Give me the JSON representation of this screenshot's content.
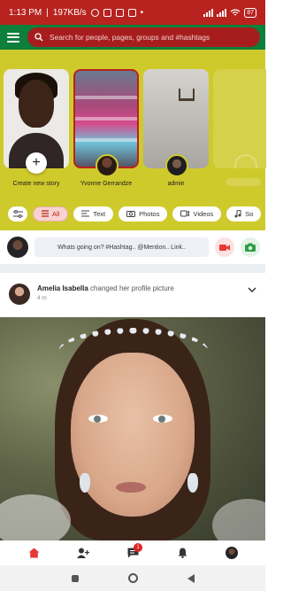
{
  "status_bar": {
    "time": "1:13 PM",
    "speed": "197KB/s",
    "battery": "87"
  },
  "header": {
    "search_placeholder": "Search for people, pages, groups and #hashtags"
  },
  "stories": {
    "create_label": "Create new story",
    "items": [
      {
        "label": "Yvonne Gerrandze"
      },
      {
        "label": "admin"
      }
    ]
  },
  "filters": {
    "items": [
      {
        "label": "All",
        "icon": "list-icon",
        "active": true
      },
      {
        "label": "Text",
        "icon": "text-icon"
      },
      {
        "label": "Photos",
        "icon": "camera-icon"
      },
      {
        "label": "Videos",
        "icon": "video-icon"
      },
      {
        "label": "So",
        "icon": "music-icon"
      }
    ]
  },
  "composer": {
    "placeholder": "Whats going on? #Hashtag.. @Mention.. Link.."
  },
  "post": {
    "author": "Amelia Isabella",
    "action": "changed her profile picture",
    "time": "4 m"
  },
  "bottom_nav": {
    "items": [
      {
        "icon": "home-icon",
        "active": true
      },
      {
        "icon": "add-friend-icon"
      },
      {
        "icon": "messages-icon",
        "badge": "1"
      },
      {
        "icon": "bell-icon"
      },
      {
        "icon": "profile-avatar"
      }
    ]
  },
  "colors": {
    "status_bar": "#b8231f",
    "header": "#0d7e3b",
    "search": "#a71d1d",
    "stories_bg": "#cfca2b",
    "accent": "#d22"
  }
}
